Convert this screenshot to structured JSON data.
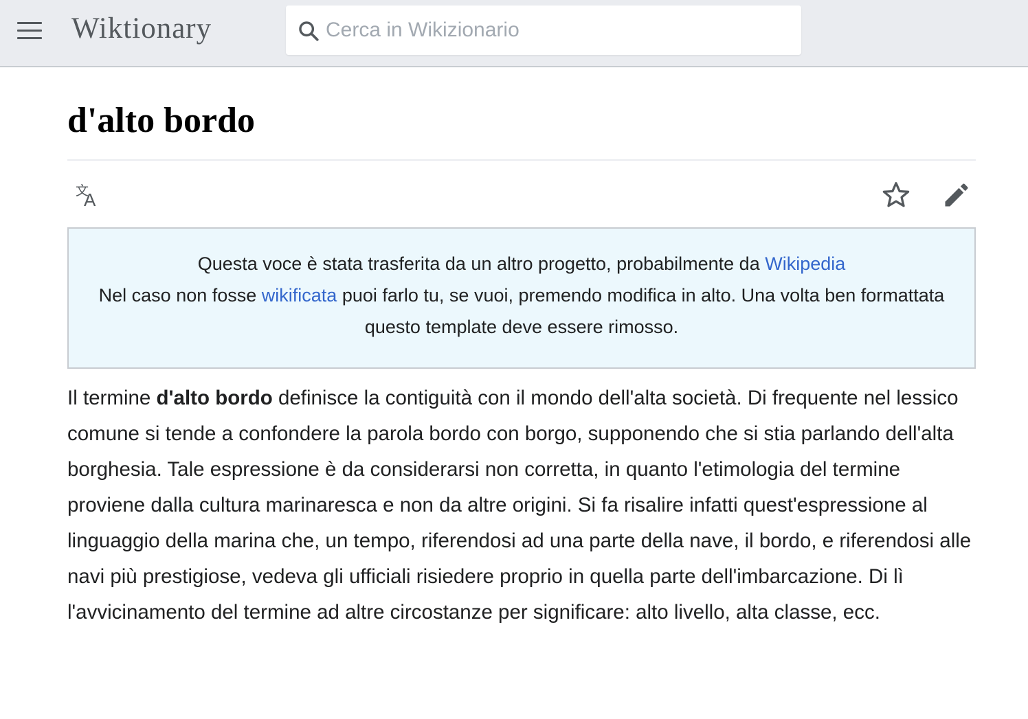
{
  "header": {
    "menu_icon": "hamburger-menu-icon",
    "logo": "Wiktionary",
    "search": {
      "icon": "search-icon",
      "placeholder": "Cerca in Wikizionario"
    }
  },
  "page": {
    "title": "d'alto bordo",
    "actions": {
      "language_icon": "translate-language-icon",
      "watch_icon": "star-icon",
      "edit_icon": "pencil-icon"
    }
  },
  "notice": {
    "line1_text": "Questa voce è stata trasferita da un altro progetto, probabilmente da ",
    "line1_link": "Wikipedia",
    "line2_pre": "Nel caso non fosse ",
    "line2_link": "wikificata",
    "line2_post": " puoi farlo tu, se vuoi, premendo modifica in alto. Una volta ben formattata questo template deve essere rimosso."
  },
  "content": {
    "intro": "Il termine ",
    "term": "d'alto bordo",
    "paragraph": " definisce la contiguità con il mondo dell'alta società. Di frequente nel lessico comune si tende a confondere la parola bordo con borgo, supponendo che si stia parlando dell'alta borghesia. Tale espressione è da considerarsi non corretta, in quanto l'etimologia del termine proviene dalla cultura marinaresca e non da altre origini. Si fa risalire infatti quest'espressione al linguaggio della marina che, un tempo, riferendosi ad una parte della nave, il bordo, e riferendosi alle navi più prestigiose, vedeva gli ufficiali risiedere proprio in quella parte dell'imbarcazione. Di lì l'avvicinamento del termine ad altre circostanze per significare: alto livello, alta classe, ecc."
  },
  "colors": {
    "header_bg": "#eaecf0",
    "notice_bg": "#ecf8fd",
    "link": "#3366cc",
    "icon": "#54595d"
  }
}
